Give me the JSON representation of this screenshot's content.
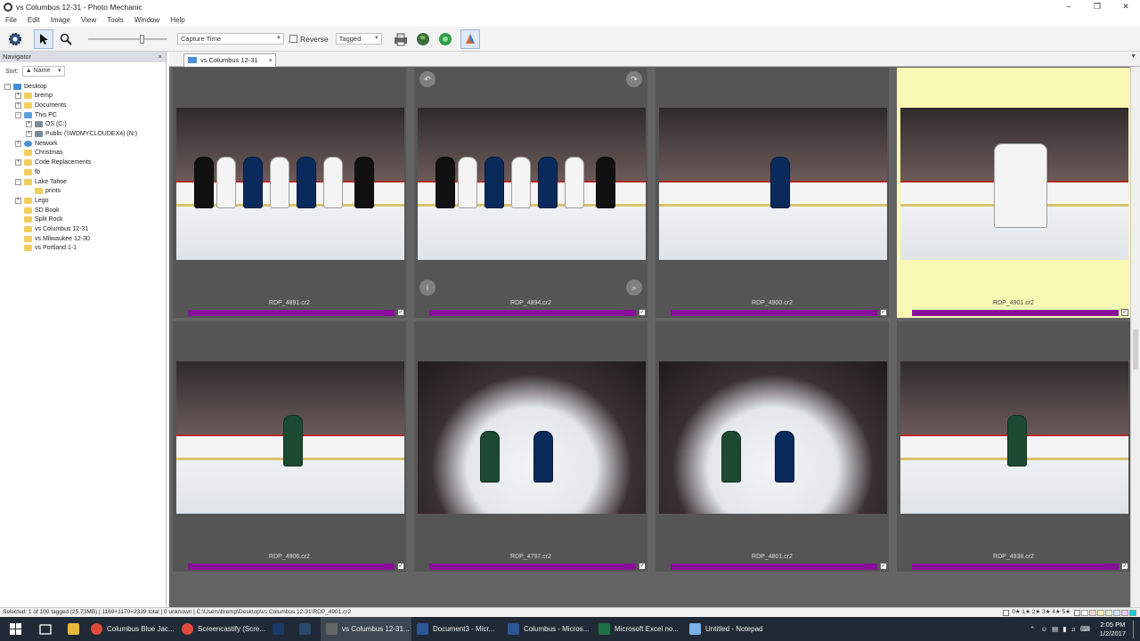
{
  "window": {
    "title": "vs Columbus 12-31 - Photo Mechanic"
  },
  "menu": [
    "File",
    "Edit",
    "Image",
    "View",
    "Tools",
    "Window",
    "Help"
  ],
  "toolbar": {
    "sort_field": "Capture Time",
    "reverse_label": "Reverse",
    "filter": "Tagged",
    "zoom_fraction": 0.7
  },
  "navigator": {
    "title": "Navigator",
    "sort_label": "Sort:",
    "sort_value": "▲ Name",
    "tree": [
      {
        "label": "Desktop",
        "depth": 0,
        "expander": "−",
        "icon": "blue"
      },
      {
        "label": "bremp",
        "depth": 1,
        "expander": "+",
        "icon": "folder"
      },
      {
        "label": "Documents",
        "depth": 1,
        "expander": "+",
        "icon": "folder"
      },
      {
        "label": "This PC",
        "depth": 1,
        "expander": "−",
        "icon": "pc"
      },
      {
        "label": "OS (C:)",
        "depth": 2,
        "expander": "+",
        "icon": "drive"
      },
      {
        "label": "Public (\\\\WDMYCLOUDEX4) (N:)",
        "depth": 2,
        "expander": "+",
        "icon": "drive"
      },
      {
        "label": "Network",
        "depth": 1,
        "expander": "+",
        "icon": "net"
      },
      {
        "label": "Christmas",
        "depth": 1,
        "expander": "",
        "icon": "folder"
      },
      {
        "label": "Code Replacements",
        "depth": 1,
        "expander": "+",
        "icon": "folder"
      },
      {
        "label": "fb",
        "depth": 1,
        "expander": "",
        "icon": "folder"
      },
      {
        "label": "Lake Tahoe",
        "depth": 1,
        "expander": "−",
        "icon": "folder"
      },
      {
        "label": "prints",
        "depth": 2,
        "expander": "",
        "icon": "folder"
      },
      {
        "label": "Lego",
        "depth": 1,
        "expander": "+",
        "icon": "folder"
      },
      {
        "label": "SD Book",
        "depth": 1,
        "expander": "",
        "icon": "folder"
      },
      {
        "label": "Split Rock",
        "depth": 1,
        "expander": "",
        "icon": "folder"
      },
      {
        "label": "vs Columbus 12-31",
        "depth": 1,
        "expander": "",
        "icon": "folder"
      },
      {
        "label": "vs Milwaukee 12-30",
        "depth": 1,
        "expander": "",
        "icon": "folder"
      },
      {
        "label": "vs Portland 1-1",
        "depth": 1,
        "expander": "",
        "icon": "folder"
      }
    ]
  },
  "tab": {
    "label": "vs Columbus 12-31",
    "close": "×"
  },
  "photos": [
    {
      "filename": "RDP_4891.cr2",
      "highlighted": false,
      "scene": "bench"
    },
    {
      "filename": "RDP_4894.cr2",
      "highlighted": false,
      "scene": "bench",
      "hover": true
    },
    {
      "filename": "RDP_4900.cr2",
      "highlighted": false,
      "scene": "boards"
    },
    {
      "filename": "RDP_4901.cr2",
      "highlighted": true,
      "scene": "goalie"
    },
    {
      "filename": "RDP_4906.cr2",
      "highlighted": false,
      "scene": "skater"
    },
    {
      "filename": "RDP_4797.cr2",
      "highlighted": false,
      "scene": "fisheye"
    },
    {
      "filename": "RDP_4801.cr2",
      "highlighted": false,
      "scene": "fisheye"
    },
    {
      "filename": "RDP_4938.cr2",
      "highlighted": false,
      "scene": "skater"
    }
  ],
  "overlay": {
    "info": "i",
    "zoom": "⌕",
    "rotate_left": "↶",
    "rotate_right": "↷",
    "check": "✓"
  },
  "status": {
    "text": "Selected: 1 of 100 tagged (25.73MB) | 1169+1170=2339 total | 0 unknown | C:\\Users\\bremp\\Desktop\\vs Columbus 12-31\\RDP_4901.cr2",
    "ratings": "0★ 1★ 2★ 3★ 4★ 5★"
  },
  "colors": {
    "tag_bar": "#8a0c9a",
    "highlight": "#f8f8b4",
    "grid_bg": "#646464"
  },
  "label_swatches": [
    "#ffffff",
    "#ffd5d5",
    "#fff2b0",
    "#d8f5d0",
    "#c8e8ff",
    "#f0c8ff",
    "#00d0e0"
  ],
  "taskbar": {
    "items": [
      {
        "label": "Columbus Blue Jac...",
        "icon": "chrome-icon"
      },
      {
        "label": "Screencastify (Scre...",
        "icon": "chrome-icon"
      },
      {
        "label": "",
        "icon": "photoshop-icon"
      },
      {
        "label": "",
        "icon": "lightroom-icon"
      },
      {
        "label": "vs Columbus 12-31...",
        "icon": "photo-mechanic-icon",
        "active": true
      },
      {
        "label": "Document3 - Micr...",
        "icon": "word-icon"
      },
      {
        "label": "Columbus - Micros...",
        "icon": "word-icon"
      },
      {
        "label": "Microsoft Excel no...",
        "icon": "excel-icon"
      },
      {
        "label": "Untitled - Notepad",
        "icon": "notepad-icon"
      }
    ],
    "time": "2:05 PM",
    "date": "1/2/2017"
  }
}
